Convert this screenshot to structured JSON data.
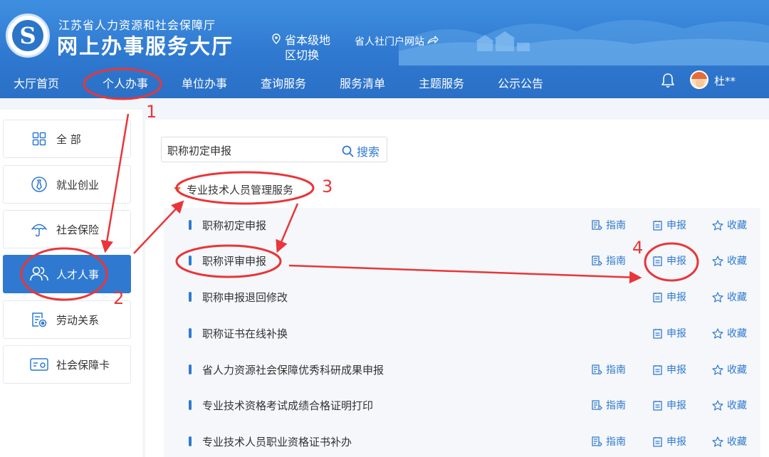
{
  "header": {
    "org_name": "江苏省人力资源和社会保障厅",
    "site_title": "网上办事服务大厅",
    "region_switch": "省本级地区切换",
    "region_line1": "省本级地",
    "region_line2": "区切换",
    "portal_link": "省人社门户网站"
  },
  "nav": {
    "items": [
      "大厅首页",
      "个人办事",
      "单位办事",
      "查询服务",
      "服务清单",
      "主题服务",
      "公示公告"
    ],
    "user": "杜**"
  },
  "sidebar": {
    "items": [
      {
        "label": "全 部",
        "icon": "grid-icon"
      },
      {
        "label": "就业创业",
        "icon": "tie-icon"
      },
      {
        "label": "社会保险",
        "icon": "umbrella-icon"
      },
      {
        "label": "人才人事",
        "icon": "people-icon"
      },
      {
        "label": "劳动关系",
        "icon": "document-seal-icon"
      },
      {
        "label": "社会保障卡",
        "icon": "card-icon"
      }
    ],
    "active_index": 3
  },
  "search": {
    "value": "职称初定申报",
    "button_label": "搜索"
  },
  "group": {
    "title": "专业技术人员管理服务"
  },
  "services": [
    {
      "title": "职称初定申报",
      "guide": "指南",
      "apply": "申报",
      "fav": "收藏"
    },
    {
      "title": "职称评审申报",
      "guide": "指南",
      "apply": "申报",
      "fav": "收藏"
    },
    {
      "title": "职称申报退回修改",
      "apply": "申报",
      "fav": "收藏"
    },
    {
      "title": "职称证书在线补换",
      "apply": "申报",
      "fav": "收藏"
    },
    {
      "title": "省人力资源社会保障优秀科研成果申报",
      "guide": "指南",
      "apply": "申报",
      "fav": "收藏"
    },
    {
      "title": "专业技术资格考试成绩合格证明打印",
      "guide": "指南",
      "apply": "申报",
      "fav": "收藏"
    },
    {
      "title": "专业技术人员职业资格证书补办",
      "guide": "指南",
      "apply": "申报",
      "fav": "收藏"
    }
  ],
  "annotations": [
    "1",
    "2",
    "3",
    "4"
  ],
  "colors": {
    "header_blue": "#2f79d0",
    "accent_blue": "#2f7ad0",
    "annotation_red": "#e8363a",
    "collapse_arrow": "#e07a2a"
  }
}
